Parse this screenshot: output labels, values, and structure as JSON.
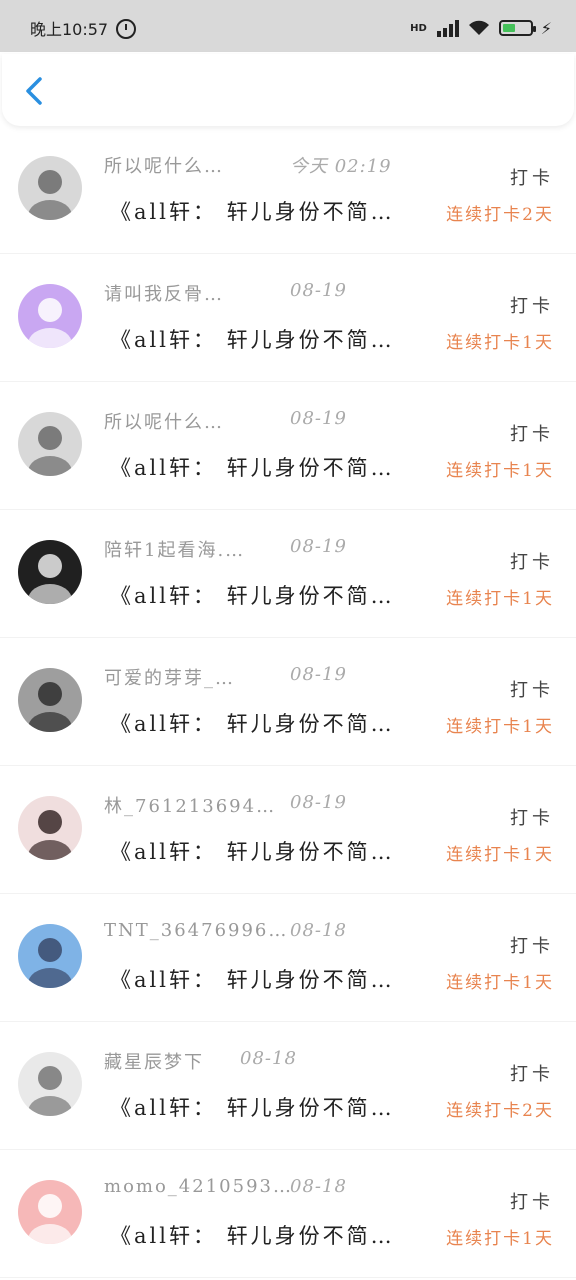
{
  "status_bar": {
    "time": "晚上10:57",
    "network": "HD",
    "battery_color": "#45c15a"
  },
  "navbar": {
    "back_icon": "chevron-left-icon",
    "accent": "#2a8fe0"
  },
  "rows": [
    {
      "name": "所以呢什么…",
      "time": "今天 02:19",
      "checkin": "打卡",
      "group": "《all轩： 轩儿身份不简…",
      "streak": "连续打卡2天",
      "avatar": {
        "bg": "#d8d8d8",
        "fg": "#6b6b6b"
      }
    },
    {
      "name": "请叫我反骨…",
      "time": "08-19",
      "checkin": "打卡",
      "group": "《all轩： 轩儿身份不简…",
      "streak": "连续打卡1天",
      "avatar": {
        "bg": "#c9a7f2",
        "fg": "#ffffff"
      }
    },
    {
      "name": "所以呢什么…",
      "time": "08-19",
      "checkin": "打卡",
      "group": "《all轩： 轩儿身份不简…",
      "streak": "连续打卡1天",
      "avatar": {
        "bg": "#d8d8d8",
        "fg": "#6b6b6b"
      }
    },
    {
      "name": "陪轩1起看海.…",
      "time": "08-19",
      "checkin": "打卡",
      "group": "《all轩： 轩儿身份不简…",
      "streak": "连续打卡1天",
      "avatar": {
        "bg": "#202020",
        "fg": "#eaeaea"
      }
    },
    {
      "name": "可爱的芽芽_…",
      "time": "08-19",
      "checkin": "打卡",
      "group": "《all轩： 轩儿身份不简…",
      "streak": "连续打卡1天",
      "avatar": {
        "bg": "#9e9e9e",
        "fg": "#2e2e2e"
      }
    },
    {
      "name": "林_761213694…",
      "time": "08-19",
      "checkin": "打卡",
      "group": "《all轩： 轩儿身份不简…",
      "streak": "连续打卡1天",
      "avatar": {
        "bg": "#f0dede",
        "fg": "#3a2a2a"
      }
    },
    {
      "name": "TNT_36476996…",
      "time": "08-18",
      "checkin": "打卡",
      "group": "《all轩： 轩儿身份不简…",
      "streak": "连续打卡1天",
      "avatar": {
        "bg": "#7fb3e6",
        "fg": "#3a4a6b"
      }
    },
    {
      "name": "藏星辰梦下",
      "time": "08-18",
      "checkin": "打卡",
      "group": "《all轩： 轩儿身份不简…",
      "streak": "连续打卡2天",
      "avatar": {
        "bg": "#e9e9e9",
        "fg": "#777777"
      }
    },
    {
      "name": "momo_4210593…",
      "time": "08-18",
      "checkin": "打卡",
      "group": "《all轩： 轩儿身份不简…",
      "streak": "连续打卡1天",
      "avatar": {
        "bg": "#f6b8b8",
        "fg": "#ffffff"
      }
    }
  ]
}
